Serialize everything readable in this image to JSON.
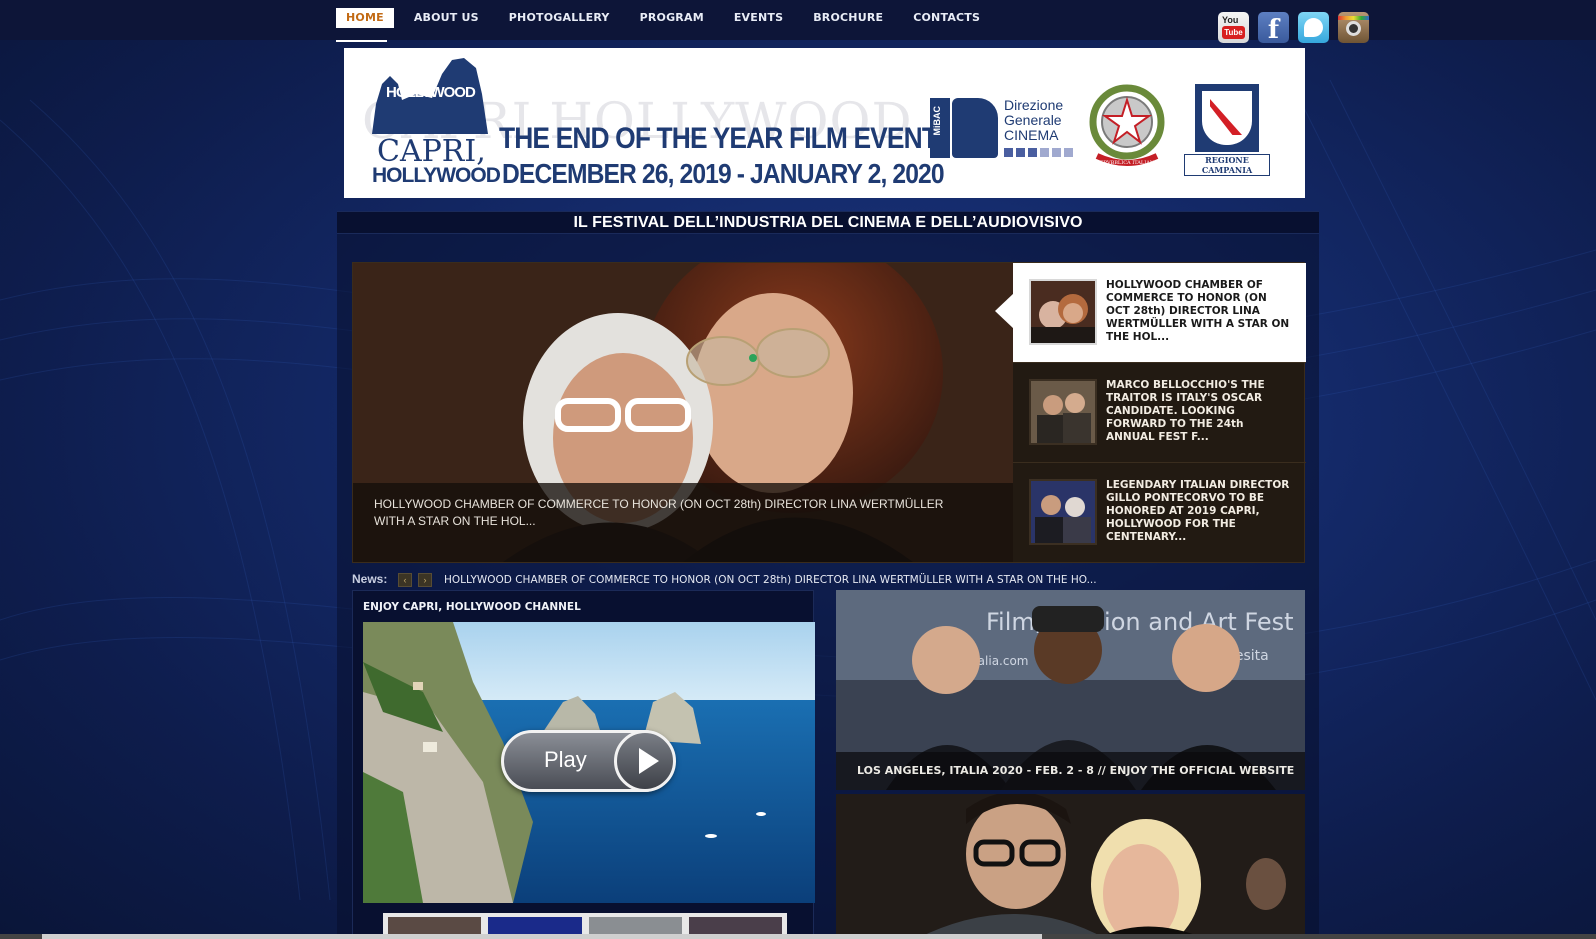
{
  "nav": {
    "items": [
      {
        "label": "HOME",
        "active": true
      },
      {
        "label": "ABOUT US"
      },
      {
        "label": "PHOTOGALLERY"
      },
      {
        "label": "PROGRAM"
      },
      {
        "label": "EVENTS"
      },
      {
        "label": "BROCHURE"
      },
      {
        "label": "CONTACTS"
      }
    ]
  },
  "social": [
    {
      "icon": "youtube-icon",
      "label_top": "You",
      "label_bottom": "Tube"
    },
    {
      "icon": "facebook-icon",
      "glyph": "f"
    },
    {
      "icon": "twitter-icon"
    },
    {
      "icon": "instagram-icon"
    }
  ],
  "banner": {
    "ghost_text": "CAPRI HOLLYWOOD",
    "logo_hollywood": "HOLLYWOOD",
    "logo_capri": "CAPRI,",
    "logo_hollywood2": "HOLLYWOOD",
    "headline": "THE END OF THE YEAR FILM EVENT",
    "dates": "DECEMBER 26, 2019 - JANUARY 2, 2020",
    "mibac_label": "MiBAC",
    "mibac_text_1": "Direzione",
    "mibac_text_2": "Generale",
    "mibac_text_3": "CINEMA",
    "emblem_label": "REPVBBLICA ITALIANA",
    "campania_label": "REGIONE CAMPANIA"
  },
  "festival_title": "IL FESTIVAL DELL’INDUSTRIA DEL CINEMA E DELL’AUDIOVISIVO",
  "slider": {
    "caption": "HOLLYWOOD CHAMBER OF COMMERCE TO HONOR (ON OCT 28th) DIRECTOR LINA WERTMÜLLER WITH A STAR ON THE HOL...",
    "items": [
      {
        "title": "HOLLYWOOD CHAMBER OF COMMERCE TO HONOR (ON OCT 28th) DIRECTOR LINA WERTMÜLLER WITH A STAR ON THE HOL...",
        "active": true
      },
      {
        "title": "MARCO BELLOCCHIO'S THE TRAITOR IS ITALY'S OSCAR CANDIDATE. LOOKING FORWARD TO THE 24th ANNUAL FEST F..."
      },
      {
        "title": "LEGENDARY ITALIAN DIRECTOR GILLO PONTECORVO TO BE HONORED AT 2019 CAPRI, HOLLYWOOD FOR THE CENTENARY..."
      }
    ]
  },
  "news": {
    "label": "News:",
    "prev_icon": "‹",
    "next_icon": "›",
    "text": "HOLLYWOOD CHAMBER OF COMMERCE TO HONOR (ON OCT 28th) DIRECTOR LINA WERTMÜLLER WITH A STAR ON THE HO..."
  },
  "channel": {
    "title": "ENJOY CAPRI, HOLLYWOOD CHANNEL",
    "play_label": "Play"
  },
  "promo1": {
    "caption": "LOS ANGELES, ITALIA 2020 - FEB. 2 - 8 // ENJOY THE OFFICIAL WEBSITE",
    "backdrop_text": "Film, Fashion and Art Fest",
    "backdrop_url": "esitalia.com",
    "backdrop_url2": "angelesita"
  }
}
